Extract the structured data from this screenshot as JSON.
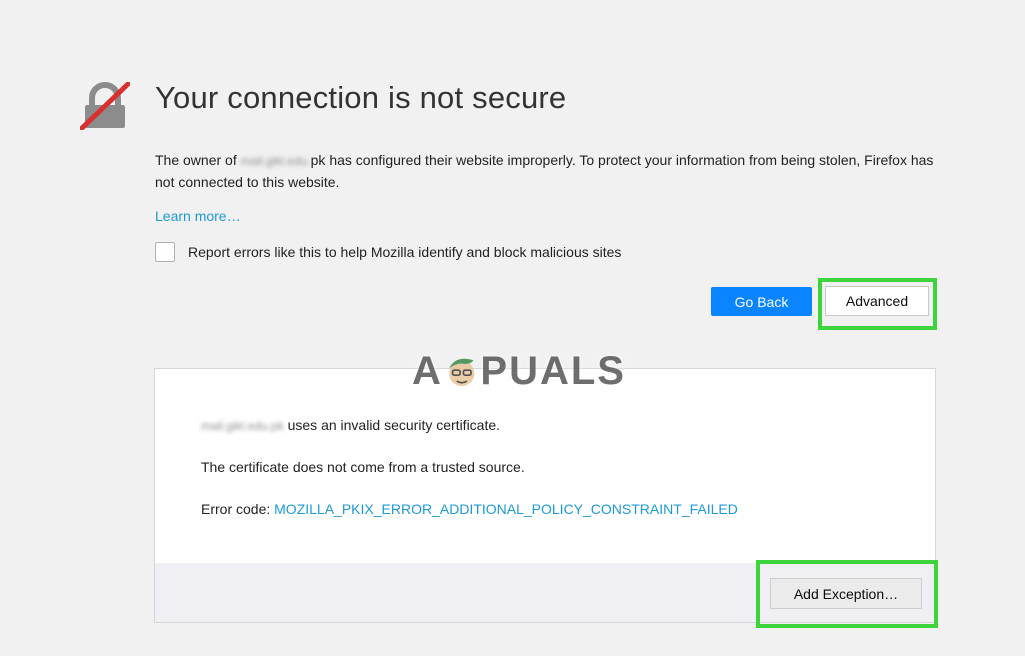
{
  "page": {
    "title": "Your connection is not secure",
    "desc_prefix": "The owner of",
    "hidden_host": "mail.gikl.edu.",
    "desc_host_suffix": "pk",
    "desc_rest": " has configured their website improperly. To protect your information from being stolen, Firefox has not connected to this website.",
    "learn_more": "Learn more…",
    "report_label": "Report errors like this to help Mozilla identify and block malicious sites",
    "report_checked": false
  },
  "buttons": {
    "go_back": "Go Back",
    "advanced": "Advanced",
    "add_exception": "Add Exception…"
  },
  "advanced_panel": {
    "host": "mail.gikl.edu.pk",
    "invalid_cert_text": " uses an invalid security certificate.",
    "untrusted_text": "The certificate does not come from a trusted source.",
    "error_code_label": "Error code: ",
    "error_code": "MOZILLA_PKIX_ERROR_ADDITIONAL_POLICY_CONSTRAINT_FAILED"
  },
  "watermark": {
    "left": "A",
    "right": "PUALS"
  },
  "colors": {
    "background": "#f1f1f1",
    "primary_button": "#0a84ff",
    "link": "#1d9ad6",
    "highlight": "#3cd43a",
    "lock_slash": "#d8302f"
  },
  "icons": {
    "lock": "broken-lock-icon"
  }
}
